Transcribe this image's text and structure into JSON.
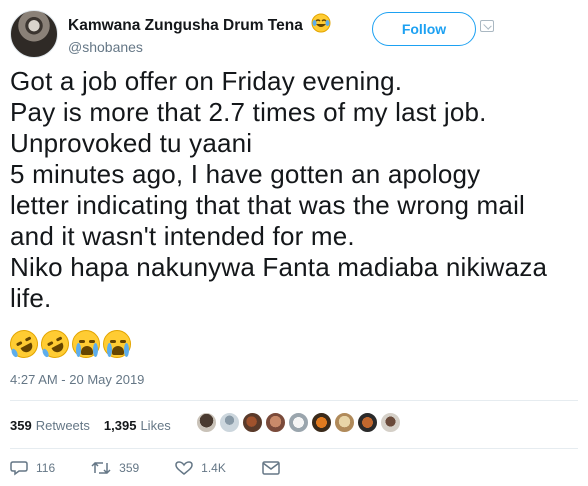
{
  "user": {
    "display_name": "Kamwana Zungusha Drum Tena",
    "handle": "@shobanes",
    "follow_label": "Follow"
  },
  "tweet": {
    "lines": [
      "Got a job offer on Friday evening.",
      "Pay is more that 2.7 times of my last job.",
      "Unprovoked tu yaani",
      "5 minutes ago, I have gotten an apology",
      "letter indicating that that was the wrong mail",
      "and it wasn't intended for me.",
      "Niko hapa nakunywa Fanta madiaba nikiwaza",
      "life."
    ],
    "emojis": [
      "rolling-on-floor-laughing",
      "rolling-on-floor-laughing",
      "loudly-crying-face",
      "loudly-crying-face"
    ],
    "timestamp": "4:27 AM - 20 May 2019"
  },
  "stats": {
    "retweets_count": "359",
    "retweets_label": "Retweets",
    "likes_count": "1,395",
    "likes_label": "Likes"
  },
  "actions": {
    "reply_count": "116",
    "retweet_count": "359",
    "like_count": "1.4K"
  },
  "colors": {
    "accent": "#1da1f2",
    "muted": "#657786",
    "text": "#14171a",
    "divider": "#e6ecf0"
  }
}
